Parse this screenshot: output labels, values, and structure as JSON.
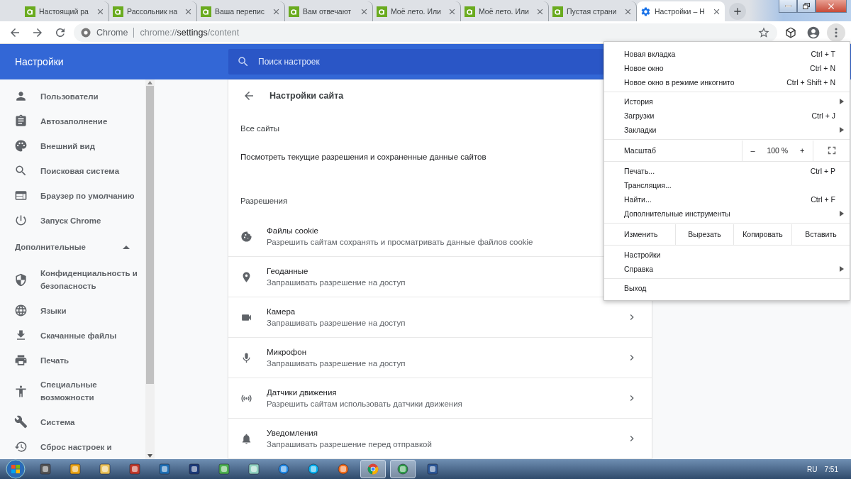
{
  "browser_tabs": [
    {
      "title": "Настоящий ра",
      "kind": "site",
      "selected": false
    },
    {
      "title": "Рассольник на",
      "kind": "site",
      "selected": false
    },
    {
      "title": "Ваша перепис",
      "kind": "site",
      "selected": false
    },
    {
      "title": "Вам отвечают",
      "kind": "site",
      "selected": false
    },
    {
      "title": "Моё лето. Или",
      "kind": "site",
      "selected": false
    },
    {
      "title": "Моё лето. Или",
      "kind": "site",
      "selected": false
    },
    {
      "title": "Пустая страни",
      "kind": "site",
      "selected": false
    },
    {
      "title": "Настройки – Н",
      "kind": "settings",
      "selected": true
    }
  ],
  "address_bar": {
    "site_label": "Chrome",
    "url_scheme": "chrome://",
    "url_host": "settings",
    "url_path": "/content"
  },
  "settings_header": {
    "title": "Настройки",
    "search": {
      "placeholder": "Поиск настроек"
    }
  },
  "sidebar": {
    "items": [
      "Пользователи",
      "Автозаполнение",
      "Внешний вид",
      "Поисковая система",
      "Браузер по умолчанию",
      "Запуск Chrome"
    ],
    "advanced": {
      "label": "Дополнительные",
      "expanded": true,
      "items": [
        "Конфиденциальность и безопасность",
        "Языки",
        "Скачанные файлы",
        "Печать",
        "Специальные возможности",
        "Система",
        "Сброс настроек и"
      ]
    }
  },
  "site_settings": {
    "title": "Настройки сайта",
    "all_sites": {
      "heading": "Все сайты",
      "link": "Посмотреть текущие разрешения и сохраненные данные сайтов"
    },
    "permissions": {
      "heading": "Разрешения",
      "rows": [
        {
          "title": "Файлы cookie",
          "subtitle": "Разрешить сайтам сохранять и просматривать данные файлов cookie"
        },
        {
          "title": "Геоданные",
          "subtitle": "Запрашивать разрешение на доступ"
        },
        {
          "title": "Камера",
          "subtitle": "Запрашивать разрешение на доступ",
          "arrow": true
        },
        {
          "title": "Микрофон",
          "subtitle": "Запрашивать разрешение на доступ",
          "arrow": true
        },
        {
          "title": "Датчики движения",
          "subtitle": "Разрешить сайтам использовать датчики движения",
          "arrow": true
        },
        {
          "title": "Уведомления",
          "subtitle": "Запрашивать разрешение перед отправкой",
          "arrow": true
        }
      ]
    }
  },
  "menu": {
    "groups": [
      [
        {
          "kind": "item",
          "label": "Новая вкладка",
          "shortcut": "Ctrl + T",
          "submenu": false
        },
        {
          "kind": "item",
          "label": "Новое окно",
          "shortcut": "Ctrl + N",
          "submenu": false
        },
        {
          "kind": "item",
          "label": "Новое окно в режиме инкогнито",
          "shortcut": "Ctrl + Shift + N",
          "submenu": false
        }
      ],
      [
        {
          "kind": "item",
          "label": "История",
          "submenu": true
        },
        {
          "kind": "item",
          "label": "Загрузки",
          "shortcut": "Ctrl + J",
          "submenu": false
        },
        {
          "kind": "item",
          "label": "Закладки",
          "submenu": true
        }
      ],
      [
        {
          "kind": "zoom",
          "label": "Масштаб",
          "minus": "–",
          "value": "100 %",
          "plus": "+"
        }
      ],
      [
        {
          "kind": "item",
          "label": "Печать...",
          "shortcut": "Ctrl + P",
          "submenu": false
        },
        {
          "kind": "item",
          "label": "Трансляция...",
          "submenu": false
        },
        {
          "kind": "item",
          "label": "Найти...",
          "shortcut": "Ctrl + F",
          "submenu": false
        },
        {
          "kind": "item",
          "label": "Дополнительные инструменты",
          "submenu": true
        }
      ],
      [
        {
          "kind": "edit",
          "label": "Изменить",
          "actions": [
            "Вырезать",
            "Копировать",
            "Вставить"
          ]
        }
      ],
      [
        {
          "kind": "item",
          "label": "Настройки",
          "submenu": false
        },
        {
          "kind": "item",
          "label": "Справка",
          "submenu": true
        }
      ],
      [
        {
          "kind": "item",
          "label": "Выход",
          "submenu": false
        }
      ]
    ]
  },
  "taskbar": {
    "apps": [
      {
        "selected": false
      },
      {
        "selected": false
      },
      {
        "selected": false
      },
      {
        "selected": false
      },
      {
        "selected": false
      },
      {
        "selected": false
      },
      {
        "selected": false
      },
      {
        "selected": false
      },
      {
        "selected": false
      },
      {
        "selected": false
      },
      {
        "selected": false
      },
      {
        "selected": true
      },
      {
        "selected": true
      },
      {
        "selected": false
      }
    ],
    "language": "RU",
    "time": "7:51"
  }
}
